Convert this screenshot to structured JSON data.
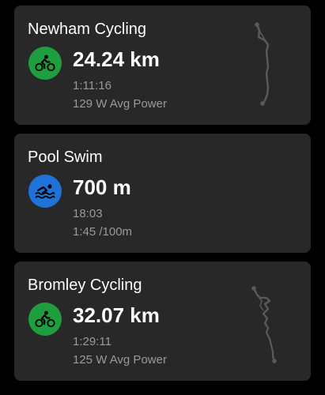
{
  "activities": [
    {
      "title": "Newham Cycling",
      "sport_icon": "cycling-icon",
      "icon_color": "#1e9e3e",
      "primary": "24.24 km",
      "line2": "1:11:16",
      "line3": "129 W Avg Power",
      "has_route_map": true
    },
    {
      "title": "Pool Swim",
      "sport_icon": "swimming-icon",
      "icon_color": "#1e73d8",
      "primary": "700 m",
      "line2": "18:03",
      "line3": "1:45 /100m",
      "has_route_map": false
    },
    {
      "title": "Bromley Cycling",
      "sport_icon": "cycling-icon",
      "icon_color": "#1e9e3e",
      "primary": "32.07 km",
      "line2": "1:29:11",
      "line3": "125 W Avg Power",
      "has_route_map": true
    }
  ],
  "colors": {
    "background": "#000000",
    "card": "#282828",
    "secondary_text": "#9a9a9a",
    "route": "#5a5a5a"
  }
}
